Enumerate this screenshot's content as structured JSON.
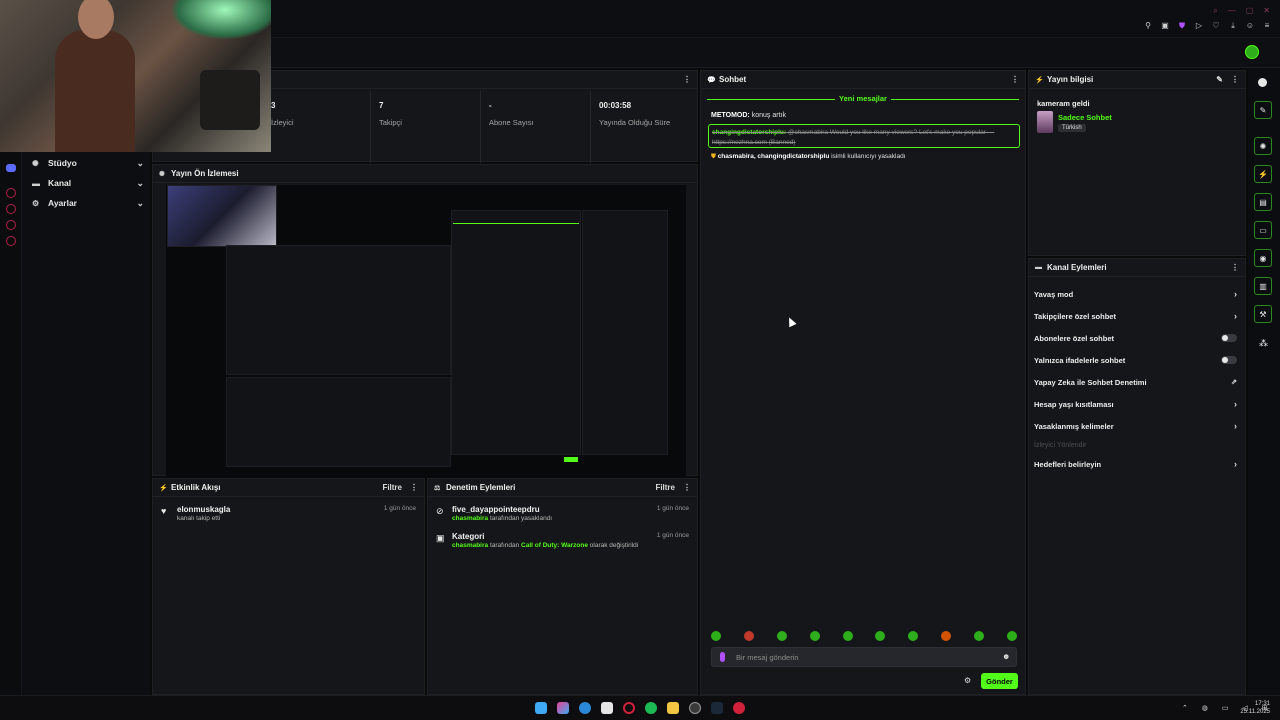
{
  "stats": [
    {
      "value": "3",
      "label": "İzleyici"
    },
    {
      "value": "7",
      "label": "Takipçi"
    },
    {
      "value": "-",
      "label": "Abone Sayısı"
    },
    {
      "value": "00:03:58",
      "label": "Yayında Olduğu Süre"
    }
  ],
  "leftmenu": {
    "items": [
      {
        "label": "Stüdyo"
      },
      {
        "label": "Kanal"
      },
      {
        "label": "Ayarlar"
      }
    ]
  },
  "preview": {
    "title": "Yayın Ön İzlemesi"
  },
  "activity": {
    "title": "Etkinlik Akışı",
    "filter": "Filtre",
    "items": [
      {
        "title": "elonmuskagla",
        "sub": "kanalı takip etti",
        "date": "1 gün önce"
      }
    ]
  },
  "moderation": {
    "title": "Denetim Eylemleri",
    "filter": "Filtre",
    "items": [
      {
        "title": "five_dayappointeepdru",
        "actor": "chasmabira",
        "sub": "tarafından yasaklandı",
        "date": "1 gün önce"
      },
      {
        "title": "Kategori",
        "actor": "chasmabira",
        "sub_pre": "tarafından",
        "game": "Call of Duty: Warzone",
        "sub_post": "olarak değiştirildi",
        "date": "1 gün önce"
      }
    ]
  },
  "chat": {
    "title": "Sohbet",
    "new_messages": "Yeni mesajlar",
    "msg1_user": "METOMOD:",
    "msg1_text": "konuş artık",
    "hl_user": "changingdictatorshiplu:",
    "hl_text": "@chasmabira Would you like many viewers? Let's make you popular — https://nezhna.com",
    "hl_banned": "(Banned)",
    "ban_users": "chasmabira, changingdictatorshiplu",
    "ban_text": "isimli kullanıcıyı yasakladı",
    "input_placeholder": "Bir mesaj gönderin",
    "send_label": "Gönder"
  },
  "streaminfo": {
    "title": "Yayın bilgisi",
    "stream_title": "kameram geldi",
    "category": "Sadece Sohbet",
    "language": "Türkish"
  },
  "channel_actions": {
    "title": "Kanal Eylemleri",
    "items": [
      {
        "label": "Yavaş mod",
        "control": "chevron"
      },
      {
        "label": "Takipçilere özel sohbet",
        "control": "chevron"
      },
      {
        "label": "Abonelere özel sohbet",
        "control": "toggle"
      },
      {
        "label": "Yalnızca ifadelerle sohbet",
        "control": "toggle"
      },
      {
        "label": "Yapay Zeka ile Sohbet Denetimi",
        "control": "external"
      },
      {
        "label": "Hesap yaşı kısıtlaması",
        "control": "chevron"
      },
      {
        "label": "Yasaklanmış kelimeler",
        "control": "chevron"
      },
      {
        "label": "İzleyici Yönlendir",
        "control": "disabled"
      },
      {
        "label": "Hedefleri belirleyin",
        "control": "chevron"
      }
    ]
  },
  "clock": {
    "time": "17:31",
    "date": "25.11.2025"
  },
  "colors": {
    "accent": "#53fc18",
    "panel": "#151619",
    "background": "#0a0a0b"
  }
}
